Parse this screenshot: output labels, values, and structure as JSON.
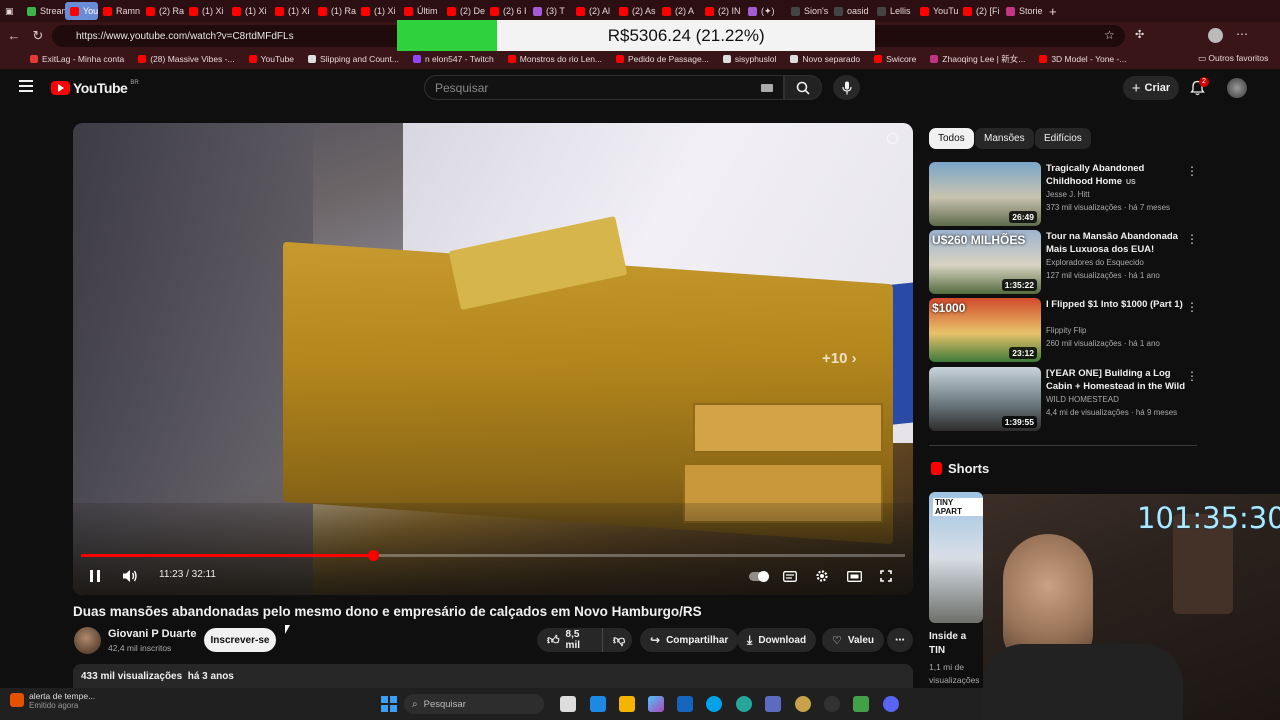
{
  "browser": {
    "tabs": [
      {
        "label": "Stream",
        "color": "#3bb54a"
      },
      {
        "label": "YouTu",
        "color": "#ff0000",
        "active": true
      },
      {
        "label": "Ramn",
        "color": "#ff0000"
      },
      {
        "label": "(2) Ra",
        "color": "#ff0000"
      },
      {
        "label": "(1) Xi",
        "color": "#ff0000"
      },
      {
        "label": "(1) Xi",
        "color": "#ff0000"
      },
      {
        "label": "(1) Xi",
        "color": "#ff0000"
      },
      {
        "label": "(1) Ra",
        "color": "#ff0000"
      },
      {
        "label": "(1) Xi",
        "color": "#ff0000"
      },
      {
        "label": "Últim",
        "color": "#ff0000"
      },
      {
        "label": "(2) De",
        "color": "#ff0000"
      },
      {
        "label": "(2) 6 I",
        "color": "#ff0000"
      },
      {
        "label": "(3) T",
        "color": "#a45cd6"
      },
      {
        "label": "(2) Al",
        "color": "#ff0000"
      },
      {
        "label": "(2) As",
        "color": "#ff0000"
      },
      {
        "label": "(2) A",
        "color": "#ff0000"
      },
      {
        "label": "(2) IN",
        "color": "#ff0000"
      },
      {
        "label": "(✦)",
        "color": "#a45cd6"
      },
      {
        "label": "Sion's",
        "color": "#444444"
      },
      {
        "label": "oasid",
        "color": "#444444"
      },
      {
        "label": "Lellis",
        "color": "#444444"
      },
      {
        "label": "YouTu",
        "color": "#ff0000"
      },
      {
        "label": "(2) [Fi",
        "color": "#ff0000"
      },
      {
        "label": "Storie",
        "color": "#c13584"
      }
    ],
    "url": "https://www.youtube.com/watch?v=C8rtdMFdFLs",
    "bookmarks": [
      {
        "label": "ExitLag - Minha conta",
        "color": "#e53935"
      },
      {
        "label": "(28) Massive Vibes -...",
        "color": "#ff0000"
      },
      {
        "label": "YouTube",
        "color": "#ff0000"
      },
      {
        "label": "Slipping and Count...",
        "color": "#dddddd"
      },
      {
        "label": "n elon547 - Twitch",
        "color": "#9146ff"
      },
      {
        "label": "Monstros do rio Len...",
        "color": "#ff0000"
      },
      {
        "label": "Pedido de Passage...",
        "color": "#ff0000"
      },
      {
        "label": "sisyphuslol",
        "color": "#dddddd"
      },
      {
        "label": "Novo separado",
        "color": "#dddddd"
      },
      {
        "label": "Swicore",
        "color": "#ff0000"
      },
      {
        "label": "Zhaoqing Lee | 新女...",
        "color": "#c13584"
      },
      {
        "label": "3D Model - Yone -...",
        "color": "#ff0000"
      }
    ],
    "other_bookmarks": "Outros favoritos"
  },
  "overlay": {
    "price_text": "R$5306.24 (21.22%)",
    "progress": 0.21
  },
  "youtube": {
    "logo_text": "YouTube",
    "region": "BR",
    "search_placeholder": "Pesquisar",
    "create_label": "Criar",
    "notification_count": "2"
  },
  "player": {
    "time_current": "11:23",
    "time_total": "32:11",
    "progress": 0.354,
    "skip_label": "+10"
  },
  "video": {
    "title": "Duas mansões abandonadas pelo mesmo dono e empresário de calçados em Novo Hamburgo/RS",
    "channel": "Giovani P Duarte",
    "subscribers": "42,4 mil inscritos",
    "subscribe_label": "Inscrever-se",
    "likes": "8,5 mil",
    "share_label": "Compartilhar",
    "download_label": "Download",
    "thanks_label": "Valeu",
    "views": "433 mil visualizações",
    "age": "há 3 anos"
  },
  "sidebar": {
    "chips": [
      "Todos",
      "Mansões",
      "Edifícios"
    ],
    "recommendations": [
      {
        "title": "Tragically Abandoned Childhood Home",
        "badge": "US",
        "channel": "Jesse J. Hitt",
        "meta": "373 mil visualizações · há 7 meses",
        "duration": "26:49",
        "colors": [
          "#7aa6c8",
          "#c9c3b0",
          "#5f6b4a"
        ]
      },
      {
        "title": "Tour na Mansão Abandonada Mais Luxuosa dos EUA!",
        "channel": "Exploradores do Esquecido",
        "meta": "127 mil visualizações · há 1 ano",
        "duration": "1:35:22",
        "thumb_text": "U$260 MILHÕES",
        "colors": [
          "#9db4cf",
          "#d8d3c2",
          "#546b3e"
        ]
      },
      {
        "title": "I Flipped $1 Into $1000 (Part 1)",
        "channel": "Flippity Flip",
        "meta": "260 mil visualizações · há 1 ano",
        "duration": "23:12",
        "thumb_text": "$1000",
        "colors": [
          "#d24a2c",
          "#e8c36a",
          "#3e7a3a"
        ]
      },
      {
        "title": "[YEAR ONE] Building a Log Cabin + Homestead in the Wild",
        "channel": "WILD HOMESTEAD",
        "meta": "4,4 mi de visualizações · há 9 meses",
        "duration": "1:39:55",
        "colors": [
          "#c9d4dc",
          "#6f7c84",
          "#2e2c2b"
        ]
      }
    ],
    "shorts_label": "Shorts",
    "short_title": "Inside a TIN Apartment",
    "short_views": "1,1 mi de visualizações",
    "short_thumb_text": "TINY APART"
  },
  "webcam": {
    "timer": "101:35:30"
  },
  "taskbar": {
    "notification_title": "alerta de tempe...",
    "notification_sub": "Emitido agora",
    "search_placeholder": "Pesquisar"
  }
}
